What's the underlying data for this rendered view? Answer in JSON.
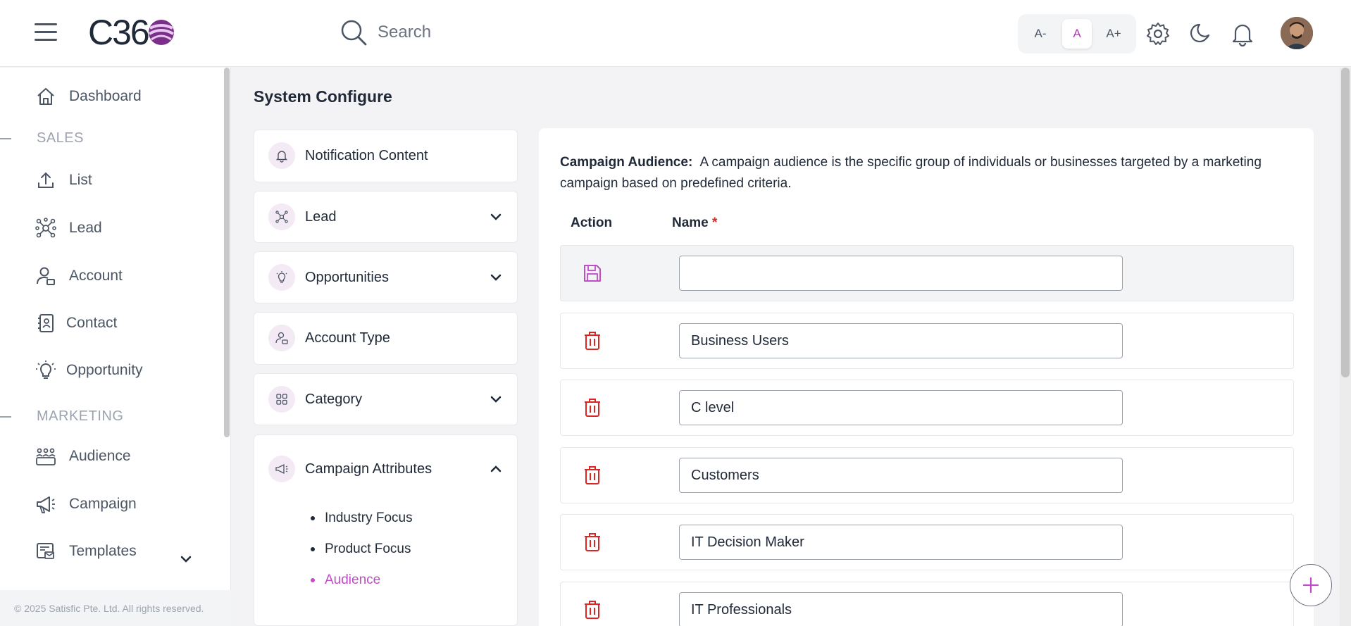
{
  "header": {
    "logo_text": "C36",
    "search_placeholder": "Search",
    "font_controls": [
      "A-",
      "A",
      "A+"
    ],
    "icons": [
      "menu-icon",
      "search-icon",
      "gear-icon",
      "moon-icon",
      "bell-icon"
    ]
  },
  "sidebar": {
    "dashboard": "Dashboard",
    "section_sales": "SALES",
    "list": "List",
    "lead": "Lead",
    "account": "Account",
    "contact": "Contact",
    "opportunity": "Opportunity",
    "section_marketing": "MARKETING",
    "audience": "Audience",
    "campaign": "Campaign",
    "templates": "Templates",
    "footer": "© 2025 Satisfic Pte. Ltd. All rights reserved."
  },
  "main": {
    "title": "System Configure",
    "menu": {
      "notification": "Notification Content",
      "lead": "Lead",
      "opportunities": "Opportunities",
      "account_type": "Account Type",
      "category": "Category",
      "campaign_attributes": "Campaign Attributes",
      "sub_items": [
        "Industry Focus",
        "Product Focus",
        "Audience"
      ],
      "active_sub_item": "Audience"
    },
    "panel": {
      "desc_label": "Campaign Audience:",
      "desc_text": "A campaign audience is the specific group of individuals or businesses targeted by a marketing campaign based on predefined criteria.",
      "col_action": "Action",
      "col_name": "Name",
      "required_mark": "*",
      "new_value": "",
      "rows": [
        "Business Users",
        "C level",
        "Customers",
        "IT Decision Maker",
        "IT Professionals"
      ]
    }
  },
  "colors": {
    "accent": "#c04cc6",
    "delete": "#dc2626"
  }
}
